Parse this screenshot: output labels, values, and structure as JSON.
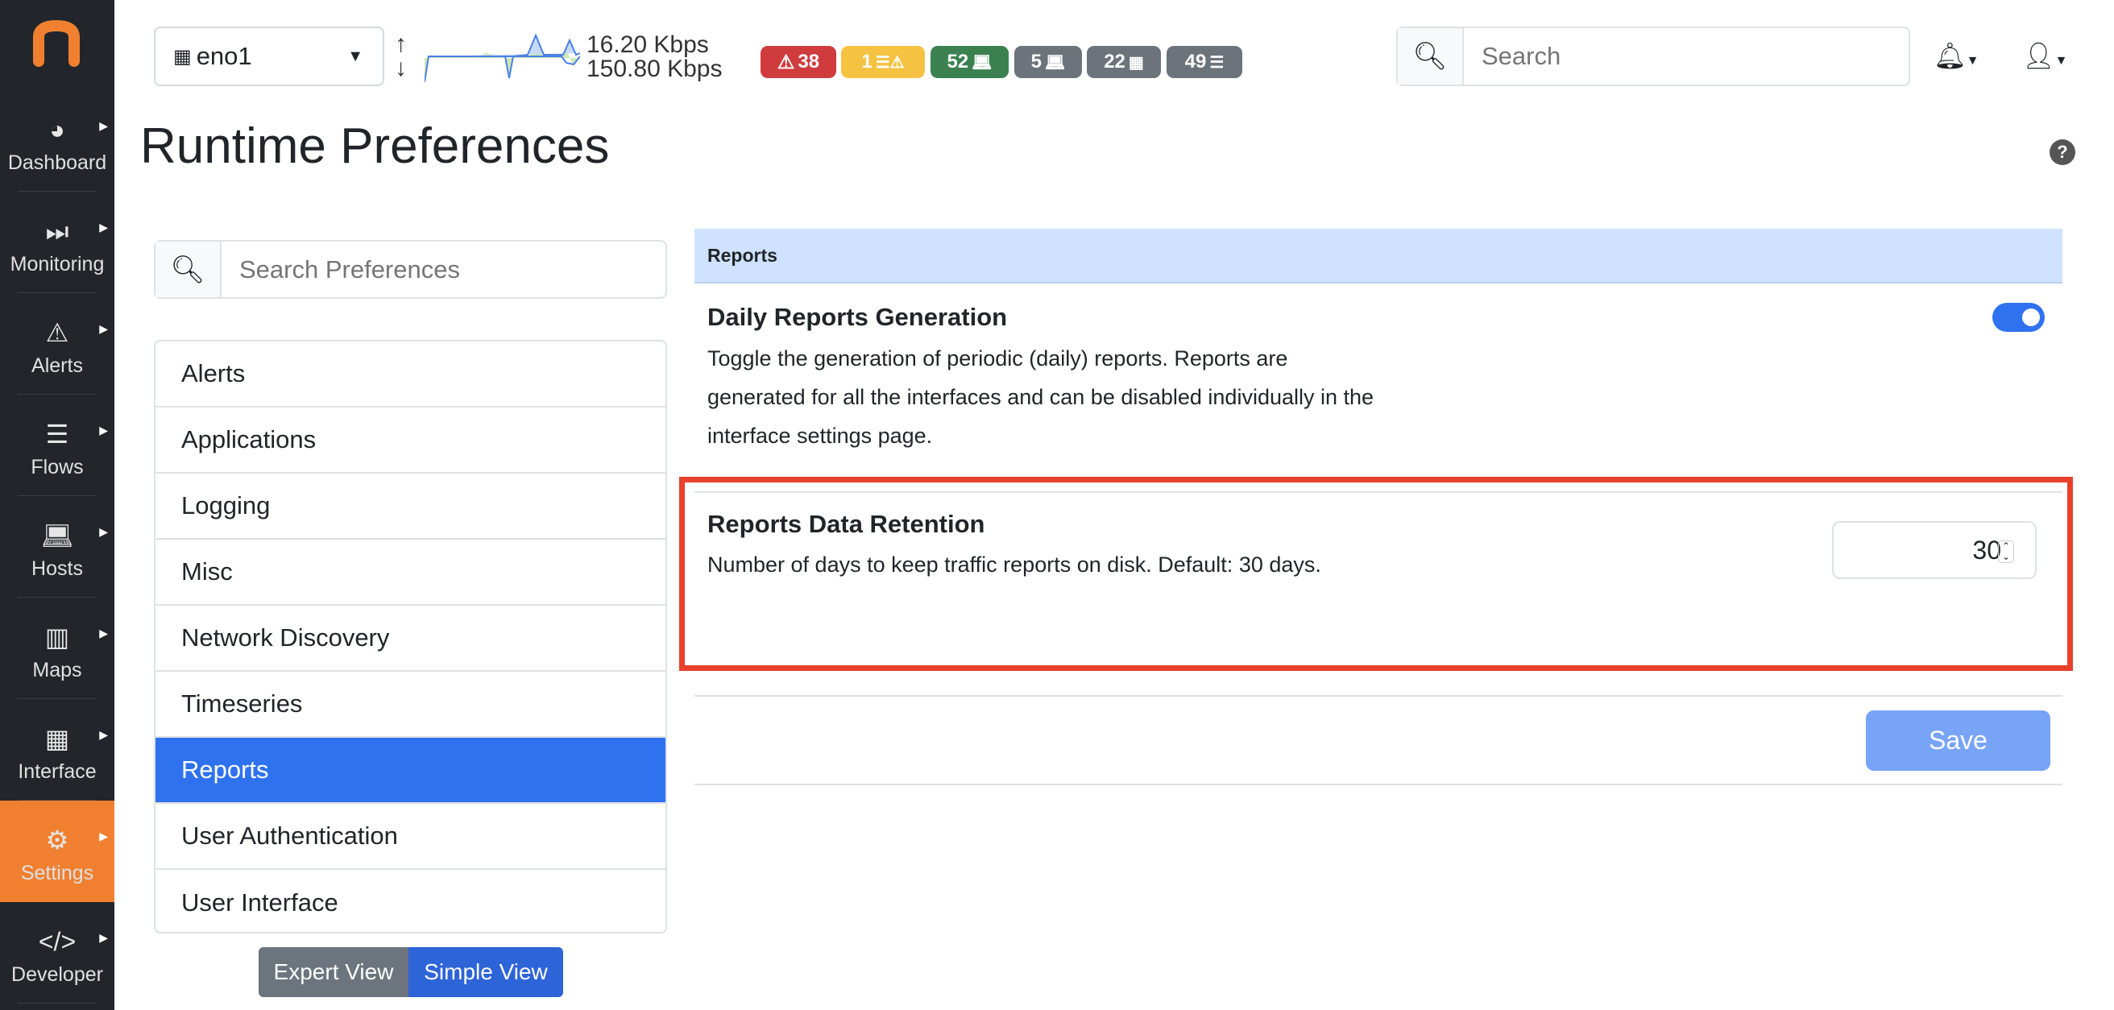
{
  "sidebar": {
    "items": [
      {
        "label": "Dashboard",
        "icon": "gauge-icon"
      },
      {
        "label": "Monitoring",
        "icon": "fast-forward-icon"
      },
      {
        "label": "Alerts",
        "icon": "warning-icon"
      },
      {
        "label": "Flows",
        "icon": "stream-icon"
      },
      {
        "label": "Hosts",
        "icon": "laptop-icon"
      },
      {
        "label": "Maps",
        "icon": "map-icon"
      },
      {
        "label": "Interface",
        "icon": "ethernet-icon"
      },
      {
        "label": "Settings",
        "icon": "gear-icon",
        "active": true
      },
      {
        "label": "Developer",
        "icon": "code-icon"
      }
    ]
  },
  "topbar": {
    "interface": "eno1",
    "upload": "16.20 Kbps",
    "download": "150.80 Kbps",
    "badges": [
      {
        "count": "38",
        "color": "#d03b3e"
      },
      {
        "count": "1",
        "color": "#f5c242"
      },
      {
        "count": "52",
        "color": "#3b8150"
      },
      {
        "count": "5",
        "color": "#6c737b"
      },
      {
        "count": "22",
        "color": "#6c737b"
      },
      {
        "count": "49",
        "color": "#6c737b"
      }
    ],
    "search_placeholder": "Search"
  },
  "page": {
    "title": "Runtime Preferences"
  },
  "prefs": {
    "search_placeholder": "Search Preferences",
    "items": [
      "Alerts",
      "Applications",
      "Logging",
      "Misc",
      "Network Discovery",
      "Timeseries",
      "Reports",
      "User Authentication",
      "User Interface"
    ],
    "active": "Reports",
    "expert_view": "Expert View",
    "simple_view": "Simple View"
  },
  "panel": {
    "header": "Reports",
    "daily": {
      "title": "Daily Reports Generation",
      "desc": "Toggle the generation of periodic (daily) reports. Reports are generated for all the interfaces and can be disabled individually in the interface settings page.",
      "enabled": true
    },
    "retention": {
      "title": "Reports Data Retention",
      "desc": "Number of days to keep traffic reports on disk. Default: 30 days.",
      "value": "30"
    },
    "save": "Save"
  }
}
